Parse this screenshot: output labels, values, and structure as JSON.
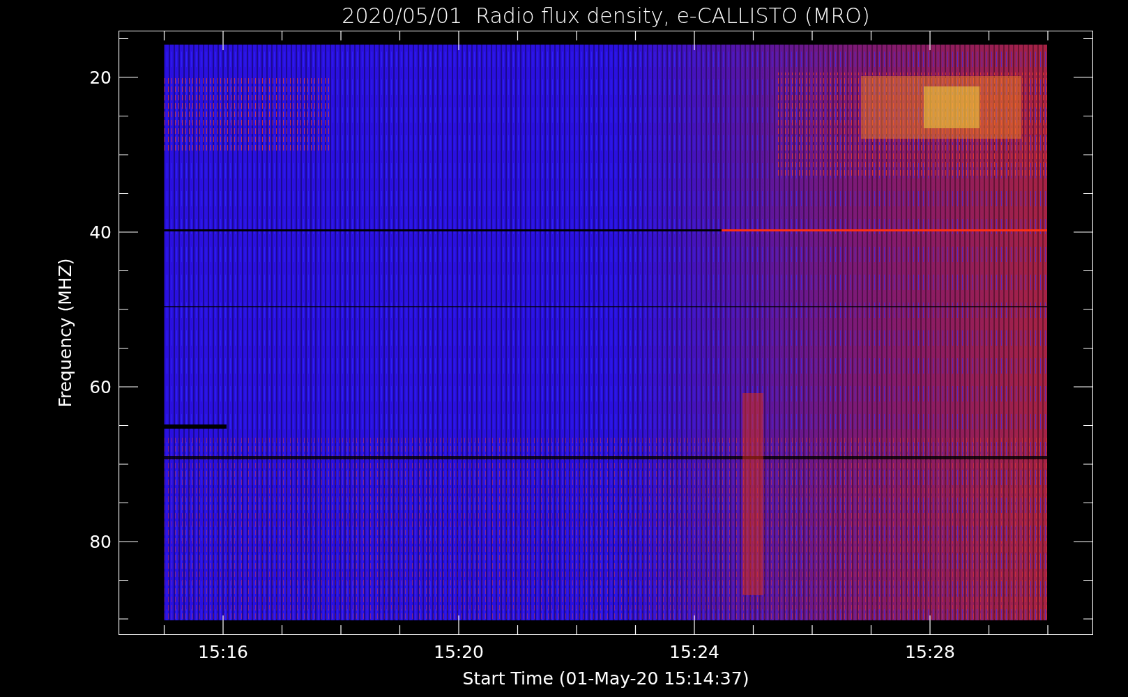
{
  "title": "2020/05/01  Radio flux density, e-CALLISTO (MRO)",
  "y_axis": {
    "label": "Frequency (MHZ)",
    "ticks": [
      "20",
      "40",
      "60",
      "80"
    ]
  },
  "x_axis": {
    "label": "Start Time (01-May-20 15:14:37)",
    "ticks": [
      "15:16",
      "15:20",
      "15:24",
      "15:28"
    ]
  }
}
